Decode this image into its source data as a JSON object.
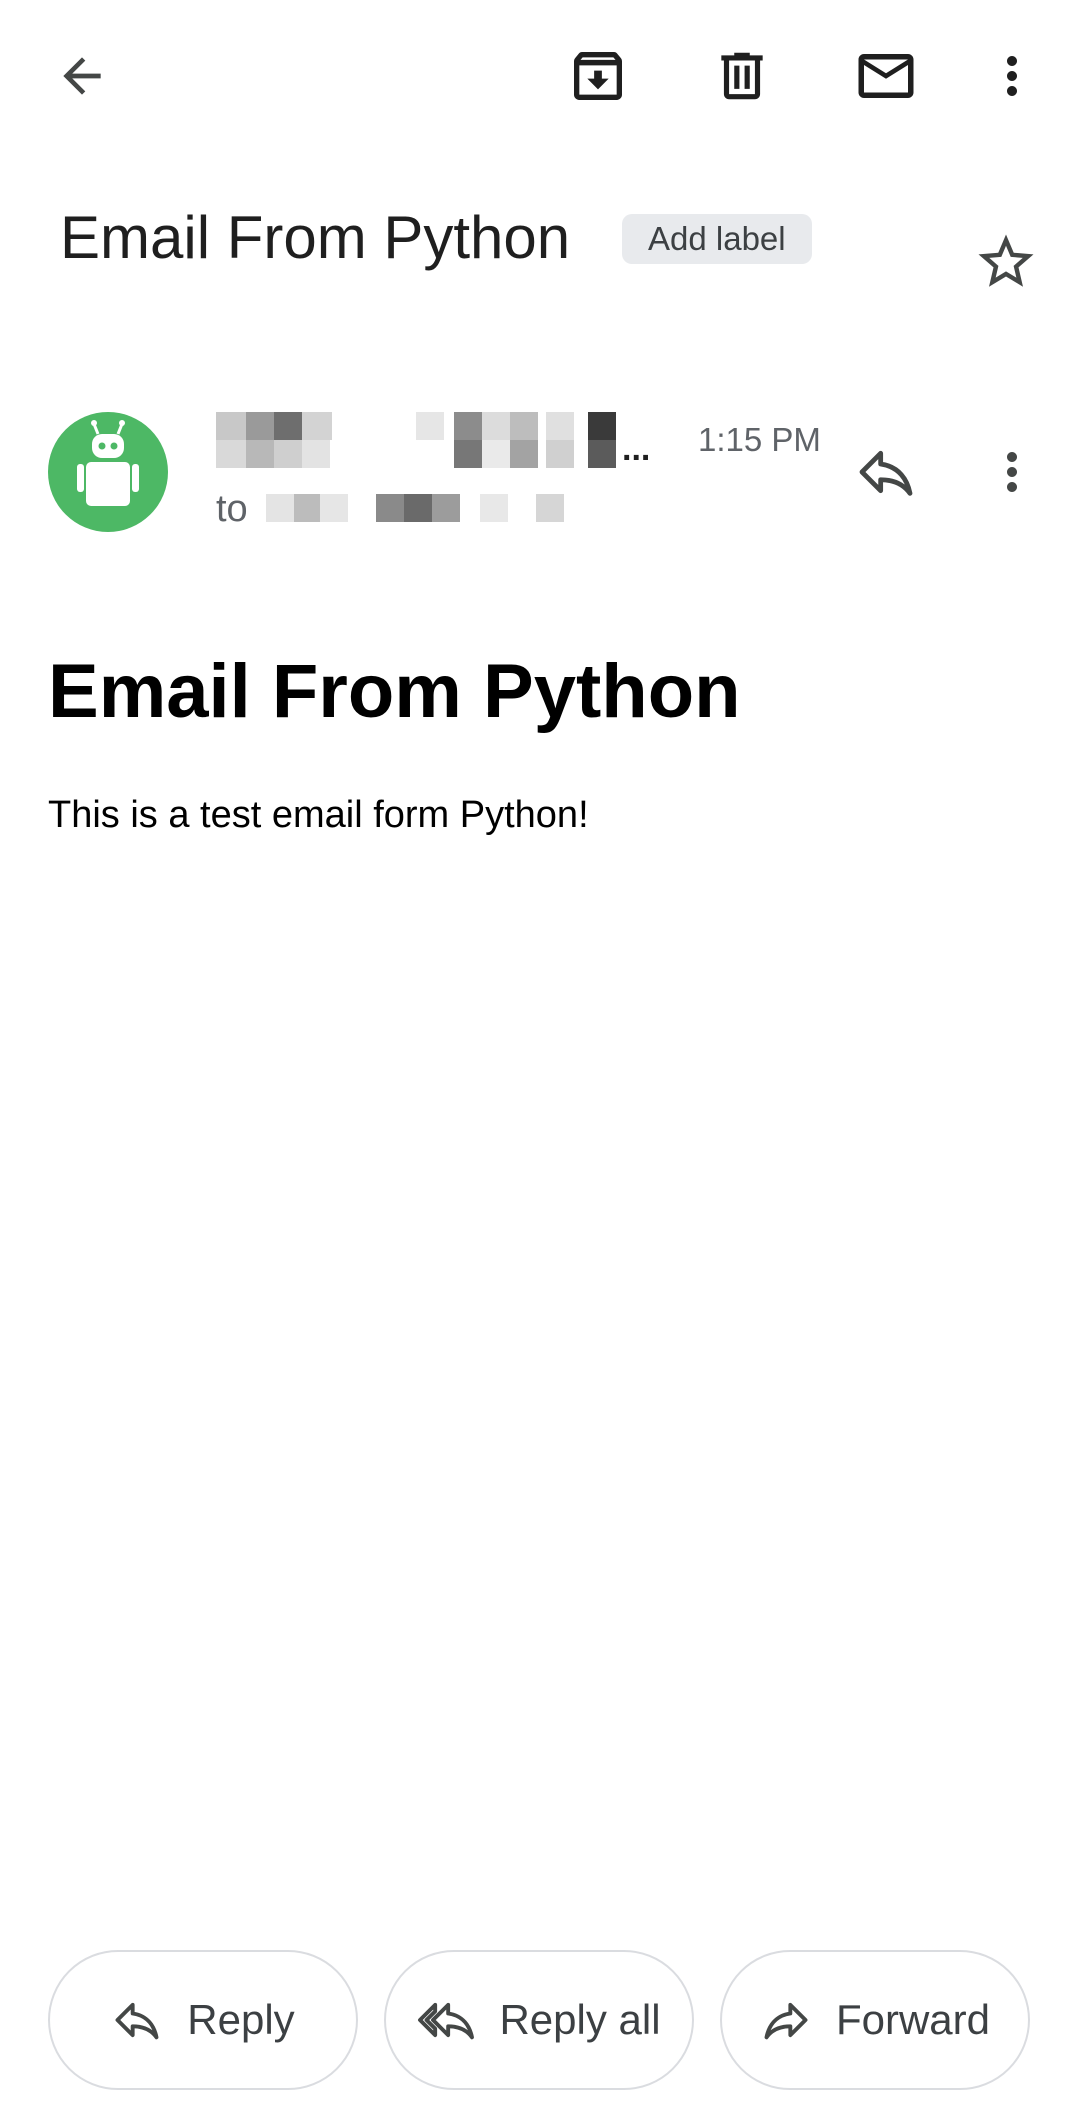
{
  "toolbar": {
    "back_icon": "arrow-back-icon",
    "archive_icon": "archive-icon",
    "delete_icon": "trash-icon",
    "mark_unread_icon": "mail-icon",
    "more_icon": "more-vert-icon"
  },
  "subject": {
    "title": "Email From Python",
    "add_label": "Add label",
    "star_icon": "star-outline-icon"
  },
  "sender": {
    "avatar_icon": "robot-avatar-icon",
    "avatar_color": "#4db865",
    "name_ellipsis": "...",
    "time": "1:15 PM",
    "to_label": "to",
    "reply_icon": "reply-icon",
    "more_icon": "more-vert-icon"
  },
  "message": {
    "heading": "Email From Python",
    "text": "This is a test email form Python!"
  },
  "actions": {
    "reply": "Reply",
    "reply_all": "Reply all",
    "forward": "Forward"
  }
}
